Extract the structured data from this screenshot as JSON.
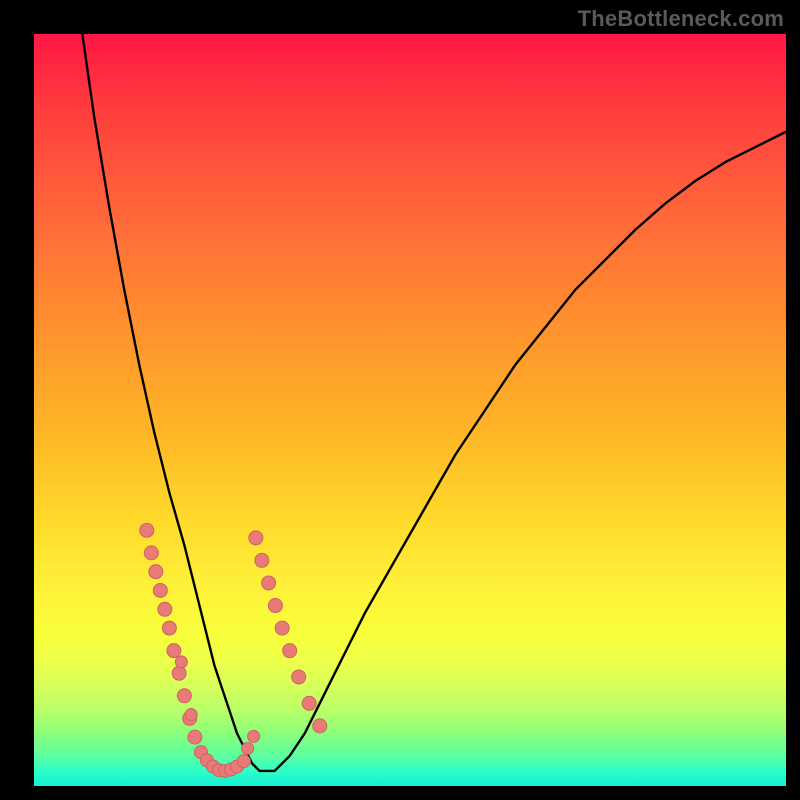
{
  "watermark": "TheBottleneck.com",
  "colors": {
    "frame": "#000000",
    "gradient_top": "#ff1744",
    "gradient_mid": "#fff23a",
    "gradient_bottom": "#14f0d6",
    "curve": "#000000",
    "marker_fill": "#e87a78",
    "marker_stroke": "#ce6360"
  },
  "chart_data": {
    "type": "line",
    "title": "",
    "xlabel": "",
    "ylabel": "",
    "xlim": [
      0,
      100
    ],
    "ylim": [
      0,
      100
    ],
    "x": [
      0,
      2,
      4,
      6,
      8,
      10,
      12,
      14,
      16,
      18,
      20,
      21,
      22,
      23,
      24,
      25,
      26,
      27,
      28,
      29,
      30,
      32,
      34,
      36,
      38,
      40,
      44,
      48,
      52,
      56,
      60,
      64,
      68,
      72,
      76,
      80,
      84,
      88,
      92,
      96,
      100
    ],
    "series": [
      {
        "name": "bottleneck-curve",
        "values": [
          155,
          135,
          118,
          103,
          89,
          77,
          66,
          56,
          47,
          39,
          32,
          28,
          24,
          20,
          16,
          13,
          10,
          7,
          5,
          3,
          2,
          2,
          4,
          7,
          11,
          15,
          23,
          30,
          37,
          44,
          50,
          56,
          61,
          66,
          70,
          74,
          77.5,
          80.5,
          83,
          85,
          87
        ]
      }
    ],
    "markers": {
      "left_cluster_x": [
        15,
        15.6,
        16.2,
        16.8,
        17.4,
        18,
        18.6,
        19.3,
        20,
        20.7,
        21.4
      ],
      "left_cluster_y": [
        34,
        31,
        28.5,
        26,
        23.5,
        21,
        18,
        15,
        12,
        9,
        6.5
      ],
      "right_cluster_x": [
        29.5,
        30.3,
        31.2,
        32.1,
        33,
        34,
        35.2,
        36.6,
        38
      ],
      "right_cluster_y": [
        33,
        30,
        27,
        24,
        21,
        18,
        14.5,
        11,
        8
      ],
      "middle_cluster_x": [
        22.2,
        23,
        23.8,
        24.6,
        25.4,
        26.2,
        27,
        27.9
      ],
      "middle_cluster_y": [
        4.5,
        3.4,
        2.6,
        2.1,
        2,
        2.2,
        2.6,
        3.3
      ],
      "sparse_x": [
        19.6,
        20.9,
        28.4,
        29.2
      ],
      "sparse_y": [
        16.5,
        9.5,
        5,
        6.6
      ]
    },
    "annotations": []
  }
}
